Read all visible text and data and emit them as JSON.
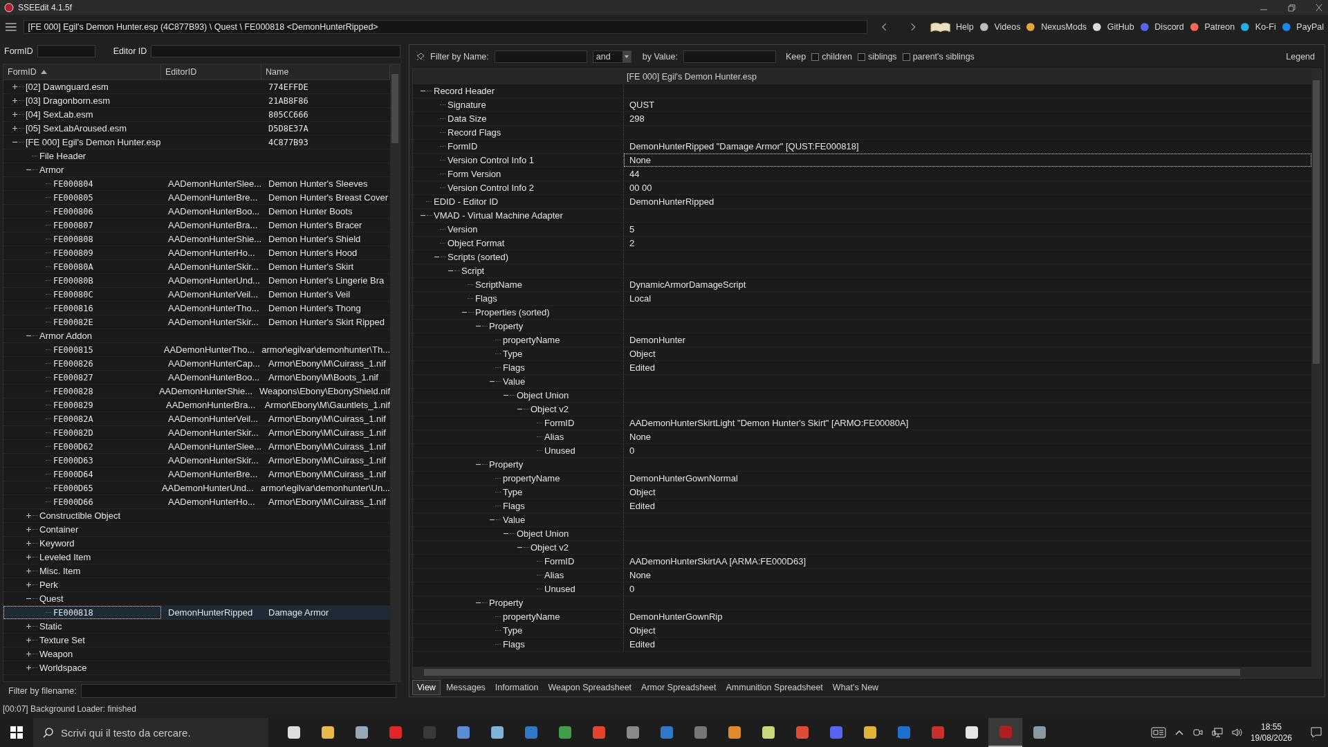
{
  "window": {
    "title": "SSEEdit 4.1.5f"
  },
  "toolbar": {
    "path": "[FE 000] Egil's Demon Hunter.esp (4C877B93) \\ Quest \\ FE000818 <DemonHunterRipped>",
    "links": [
      "Help",
      "Videos",
      "NexusMods",
      "GitHub",
      "Discord",
      "Patreon",
      "Ko-Fi",
      "PayPal"
    ]
  },
  "left_filter": {
    "form_id_label": "FormID",
    "editor_id_label": "Editor ID"
  },
  "tree": {
    "columns": [
      {
        "label": "FormID",
        "sorted": true
      },
      {
        "label": "EditorID",
        "sorted": false
      },
      {
        "label": "Name",
        "sorted": false
      }
    ],
    "nodes": [
      {
        "label": "[02] Dawnguard.esm",
        "name": "774EFFDE",
        "expanded": false,
        "selected": false
      },
      {
        "label": "[03] Dragonborn.esm",
        "name": "21AB8F86",
        "expanded": false,
        "selected": false
      },
      {
        "label": "[04] SexLab.esm",
        "name": "805CC666",
        "expanded": false,
        "selected": false
      },
      {
        "label": "[05] SexLabAroused.esm",
        "name": "D5D8E37A",
        "expanded": false,
        "selected": false
      },
      {
        "label": "[FE 000] Egil's Demon Hunter.esp",
        "name": "4C877B93",
        "expanded": true,
        "selected": false,
        "children": [
          {
            "label": "File Header",
            "selected": false
          },
          {
            "label": "Armor",
            "expanded": true,
            "selected": false,
            "children": [
              {
                "label": "FE000804",
                "editor_id": "AADemonHunterSlee...",
                "name": "Demon Hunter's Sleeves",
                "selected": false
              },
              {
                "label": "FE000805",
                "editor_id": "AADemonHunterBre...",
                "name": "Demon Hunter's Breast Cover",
                "selected": false
              },
              {
                "label": "FE000806",
                "editor_id": "AADemonHunterBoo...",
                "name": "Demon Hunter Boots",
                "selected": false
              },
              {
                "label": "FE000807",
                "editor_id": "AADemonHunterBra...",
                "name": "Demon Hunter's Bracer",
                "selected": false
              },
              {
                "label": "FE000808",
                "editor_id": "AADemonHunterShie...",
                "name": "Demon Hunter's Shield",
                "selected": false
              },
              {
                "label": "FE000809",
                "editor_id": "AADemonHunterHo...",
                "name": "Demon Hunter's Hood",
                "selected": false
              },
              {
                "label": "FE00080A",
                "editor_id": "AADemonHunterSkir...",
                "name": "Demon Hunter's Skirt",
                "selected": false
              },
              {
                "label": "FE00080B",
                "editor_id": "AADemonHunterUnd...",
                "name": "Demon Hunter's Lingerie Bra",
                "selected": false
              },
              {
                "label": "FE00080C",
                "editor_id": "AADemonHunterVeil...",
                "name": "Demon Hunter's Veil",
                "selected": false
              },
              {
                "label": "FE000816",
                "editor_id": "AADemonHunterTho...",
                "name": "Demon Hunter's Thong",
                "selected": false
              },
              {
                "label": "FE00082E",
                "editor_id": "AADemonHunterSkir...",
                "name": "Demon Hunter's Skirt Ripped",
                "selected": false
              }
            ]
          },
          {
            "label": "Armor Addon",
            "expanded": true,
            "selected": false,
            "children": [
              {
                "label": "FE000815",
                "editor_id": "AADemonHunterTho...",
                "name": "armor\\egilvar\\demonhunter\\Th...",
                "selected": false
              },
              {
                "label": "FE000826",
                "editor_id": "AADemonHunterCap...",
                "name": "Armor\\Ebony\\M\\Cuirass_1.nif",
                "selected": false
              },
              {
                "label": "FE000827",
                "editor_id": "AADemonHunterBoo...",
                "name": "Armor\\Ebony\\M\\Boots_1.nif",
                "selected": false
              },
              {
                "label": "FE000828",
                "editor_id": "AADemonHunterShie...",
                "name": "Weapons\\Ebony\\EbonyShield.nif",
                "selected": false
              },
              {
                "label": "FE000829",
                "editor_id": "AADemonHunterBra...",
                "name": "Armor\\Ebony\\M\\Gauntlets_1.nif",
                "selected": false
              },
              {
                "label": "FE00082A",
                "editor_id": "AADemonHunterVeil...",
                "name": "Armor\\Ebony\\M\\Cuirass_1.nif",
                "selected": false
              },
              {
                "label": "FE00082D",
                "editor_id": "AADemonHunterSkir...",
                "name": "Armor\\Ebony\\M\\Cuirass_1.nif",
                "selected": false
              },
              {
                "label": "FE000D62",
                "editor_id": "AADemonHunterSlee...",
                "name": "Armor\\Ebony\\M\\Cuirass_1.nif",
                "selected": false
              },
              {
                "label": "FE000D63",
                "editor_id": "AADemonHunterSkir...",
                "name": "Armor\\Ebony\\M\\Cuirass_1.nif",
                "selected": false
              },
              {
                "label": "FE000D64",
                "editor_id": "AADemonHunterBre...",
                "name": "Armor\\Ebony\\M\\Cuirass_1.nif",
                "selected": false
              },
              {
                "label": "FE000D65",
                "editor_id": "AADemonHunterUnd...",
                "name": "armor\\egilvar\\demonhunter\\Un...",
                "selected": false
              },
              {
                "label": "FE000D66",
                "editor_id": "AADemonHunterHo...",
                "name": "Armor\\Ebony\\M\\Cuirass_1.nif",
                "selected": false
              }
            ]
          },
          {
            "label": "Constructible Object",
            "expanded": false,
            "selected": false
          },
          {
            "label": "Container",
            "expanded": false,
            "selected": false
          },
          {
            "label": "Keyword",
            "expanded": false,
            "selected": false
          },
          {
            "label": "Leveled Item",
            "expanded": false,
            "selected": false
          },
          {
            "label": "Misc. Item",
            "expanded": false,
            "selected": false
          },
          {
            "label": "Perk",
            "expanded": false,
            "selected": false
          },
          {
            "label": "Quest",
            "expanded": true,
            "selected": false,
            "children": [
              {
                "label": "FE000818",
                "editor_id": "DemonHunterRipped",
                "name": "Damage Armor",
                "selected": true
              }
            ]
          },
          {
            "label": "Static",
            "expanded": false,
            "selected": false
          },
          {
            "label": "Texture Set",
            "expanded": false,
            "selected": false
          },
          {
            "label": "Weapon",
            "expanded": false,
            "selected": false
          },
          {
            "label": "Worldspace",
            "expanded": false,
            "selected": false
          }
        ]
      }
    ]
  },
  "filename_filter": {
    "label": "Filter by filename:"
  },
  "status": "[00:07] Background Loader: finished",
  "record_view": {
    "filter": {
      "name_label": "Filter by Name:",
      "operator": "and",
      "value_label": "by Value:",
      "keep_label": "Keep",
      "options": [
        {
          "label": "children",
          "checked": false
        },
        {
          "label": "siblings",
          "checked": false
        },
        {
          "label": "parent's siblings",
          "checked": false
        }
      ],
      "legend": "Legend"
    },
    "header": "[FE 000] Egil's Demon Hunter.esp",
    "nodes": [
      {
        "label": "Record Header",
        "expanded": true,
        "selected": false,
        "children": [
          {
            "label": "Signature",
            "value": "QUST",
            "selected": false
          },
          {
            "label": "Data Size",
            "value": "298",
            "selected": false
          },
          {
            "label": "Record Flags",
            "selected": false
          },
          {
            "label": "FormID",
            "value": "DemonHunterRipped \"Damage Armor\" [QUST:FE000818]",
            "selected": false
          },
          {
            "label": "Version Control Info 1",
            "value": "None",
            "selected": true
          },
          {
            "label": "Form Version",
            "value": "44",
            "selected": false
          },
          {
            "label": "Version Control Info 2",
            "value": "00 00",
            "selected": false
          }
        ]
      },
      {
        "label": "EDID - Editor ID",
        "value": "DemonHunterRipped",
        "selected": false
      },
      {
        "label": "VMAD - Virtual Machine Adapter",
        "expanded": true,
        "selected": false,
        "children": [
          {
            "label": "Version",
            "value": "5",
            "selected": false
          },
          {
            "label": "Object Format",
            "value": "2",
            "selected": false
          },
          {
            "label": "Scripts (sorted)",
            "expanded": true,
            "selected": false,
            "children": [
              {
                "label": "Script",
                "expanded": true,
                "selected": false,
                "children": [
                  {
                    "label": "ScriptName",
                    "value": "DynamicArmorDamageScript",
                    "selected": false
                  },
                  {
                    "label": "Flags",
                    "value": "Local",
                    "selected": false
                  },
                  {
                    "label": "Properties (sorted)",
                    "expanded": true,
                    "selected": false,
                    "children": [
                      {
                        "label": "Property",
                        "expanded": true,
                        "selected": false,
                        "children": [
                          {
                            "label": "propertyName",
                            "value": "DemonHunter",
                            "selected": false
                          },
                          {
                            "label": "Type",
                            "value": "Object",
                            "selected": false
                          },
                          {
                            "label": "Flags",
                            "value": "Edited",
                            "selected": false
                          },
                          {
                            "label": "Value",
                            "expanded": true,
                            "selected": false,
                            "children": [
                              {
                                "label": "Object Union",
                                "expanded": true,
                                "selected": false,
                                "children": [
                                  {
                                    "label": "Object v2",
                                    "expanded": true,
                                    "selected": false,
                                    "children": [
                                      {
                                        "label": "FormID",
                                        "value": "AADemonHunterSkirtLight \"Demon Hunter's Skirt\" [ARMO:FE00080A]",
                                        "selected": false
                                      },
                                      {
                                        "label": "Alias",
                                        "value": "None",
                                        "selected": false
                                      },
                                      {
                                        "label": "Unused",
                                        "value": "0",
                                        "selected": false
                                      }
                                    ]
                                  }
                                ]
                              }
                            ]
                          }
                        ]
                      },
                      {
                        "label": "Property",
                        "expanded": true,
                        "selected": false,
                        "children": [
                          {
                            "label": "propertyName",
                            "value": "DemonHunterGownNormal",
                            "selected": false
                          },
                          {
                            "label": "Type",
                            "value": "Object",
                            "selected": false
                          },
                          {
                            "label": "Flags",
                            "value": "Edited",
                            "selected": false
                          },
                          {
                            "label": "Value",
                            "expanded": true,
                            "selected": false,
                            "children": [
                              {
                                "label": "Object Union",
                                "expanded": true,
                                "selected": false,
                                "children": [
                                  {
                                    "label": "Object v2",
                                    "expanded": true,
                                    "selected": false,
                                    "children": [
                                      {
                                        "label": "FormID",
                                        "value": "AADemonHunterSkirtAA [ARMA:FE000D63]",
                                        "selected": false
                                      },
                                      {
                                        "label": "Alias",
                                        "value": "None",
                                        "selected": false
                                      },
                                      {
                                        "label": "Unused",
                                        "value": "0",
                                        "selected": false
                                      }
                                    ]
                                  }
                                ]
                              }
                            ]
                          }
                        ]
                      },
                      {
                        "label": "Property",
                        "expanded": true,
                        "selected": false,
                        "children": [
                          {
                            "label": "propertyName",
                            "value": "DemonHunterGownRip",
                            "selected": false
                          },
                          {
                            "label": "Type",
                            "value": "Object",
                            "selected": false
                          },
                          {
                            "label": "Flags",
                            "value": "Edited",
                            "selected": false
                          }
                        ]
                      }
                    ]
                  }
                ]
              }
            ]
          }
        ]
      }
    ]
  },
  "tabs": [
    {
      "label": "View",
      "selected": true
    },
    {
      "label": "Messages",
      "selected": false
    },
    {
      "label": "Information",
      "selected": false
    },
    {
      "label": "Weapon Spreadsheet",
      "selected": false
    },
    {
      "label": "Armor Spreadsheet",
      "selected": false
    },
    {
      "label": "Ammunition Spreadsheet",
      "selected": false
    },
    {
      "label": "What's New",
      "selected": false
    }
  ],
  "taskbar": {
    "search_placeholder": "Scrivi qui il testo da cercare.",
    "apps": [
      {
        "selected": false
      },
      {
        "selected": false
      },
      {
        "selected": false
      },
      {
        "selected": false
      },
      {
        "selected": false
      },
      {
        "selected": false
      },
      {
        "selected": false
      },
      {
        "selected": false
      },
      {
        "selected": false
      },
      {
        "selected": false
      },
      {
        "selected": false
      },
      {
        "selected": false
      },
      {
        "selected": false
      },
      {
        "selected": false
      },
      {
        "selected": false
      },
      {
        "selected": false
      },
      {
        "selected": false
      },
      {
        "selected": false
      },
      {
        "selected": false
      },
      {
        "selected": false
      },
      {
        "selected": false
      },
      {
        "selected": true
      },
      {
        "selected": false
      }
    ],
    "time": "18:55",
    "date": "19/08/2026"
  }
}
